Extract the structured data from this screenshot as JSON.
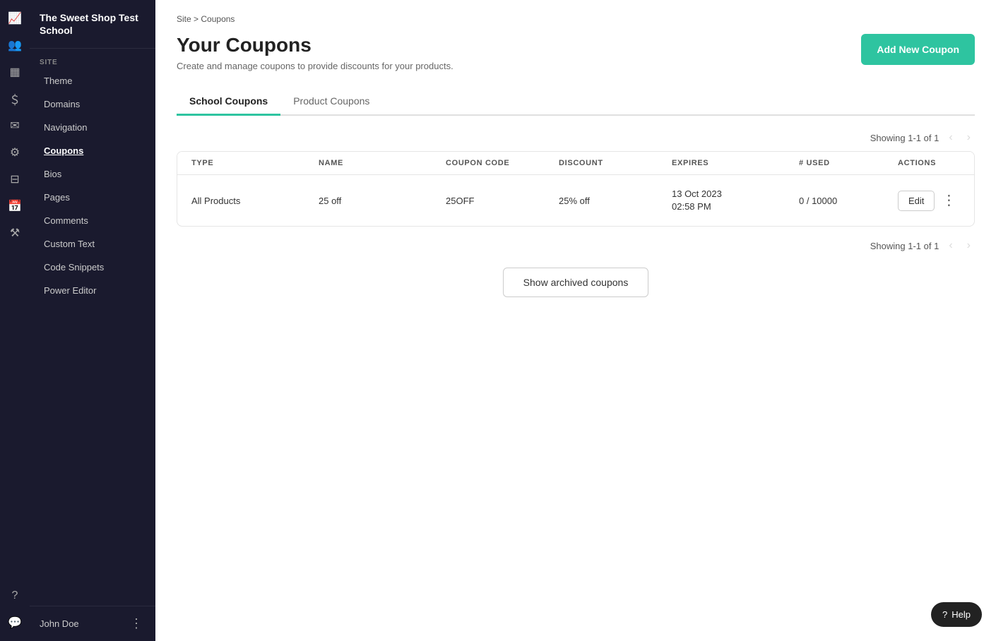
{
  "school_name": "The Sweet Shop Test School",
  "breadcrumb": {
    "site": "Site",
    "separator": ">",
    "current": "Coupons"
  },
  "page": {
    "title": "Your Coupons",
    "subtitle": "Create and manage coupons to provide discounts for your products."
  },
  "add_button_label": "Add New Coupon",
  "tabs": [
    {
      "id": "school",
      "label": "School Coupons",
      "active": true
    },
    {
      "id": "product",
      "label": "Product Coupons",
      "active": false
    }
  ],
  "pagination_top": "Showing 1-1 of 1",
  "pagination_bottom": "Showing 1-1 of 1",
  "table": {
    "headers": [
      "TYPE",
      "NAME",
      "COUPON CODE",
      "DISCOUNT",
      "EXPIRES",
      "# USED",
      "ACTIONS"
    ],
    "rows": [
      {
        "type": "All Products",
        "name": "25 off",
        "coupon_code": "25OFF",
        "discount": "25% off",
        "expires_date": "13 Oct 2023",
        "expires_time": "02:58 PM",
        "used": "0 / 10000",
        "edit_label": "Edit"
      }
    ]
  },
  "show_archived_label": "Show archived coupons",
  "sidebar": {
    "section_label": "SITE",
    "items": [
      {
        "id": "theme",
        "label": "Theme"
      },
      {
        "id": "domains",
        "label": "Domains"
      },
      {
        "id": "navigation",
        "label": "Navigation"
      },
      {
        "id": "coupons",
        "label": "Coupons",
        "active": true
      },
      {
        "id": "bios",
        "label": "Bios"
      },
      {
        "id": "pages",
        "label": "Pages"
      },
      {
        "id": "comments",
        "label": "Comments"
      },
      {
        "id": "custom-text",
        "label": "Custom Text"
      },
      {
        "id": "code-snippets",
        "label": "Code Snippets"
      },
      {
        "id": "power-editor",
        "label": "Power Editor"
      }
    ],
    "footer_user": "John Doe"
  },
  "help_label": "Help",
  "icons": {
    "activity": "📈",
    "users": "👥",
    "dashboard": "▦",
    "dollar": "＄",
    "mail": "✉",
    "settings": "⚙",
    "library": "⊟",
    "calendar": "📅",
    "tool": "⚒",
    "question": "?",
    "chat": "💬"
  }
}
